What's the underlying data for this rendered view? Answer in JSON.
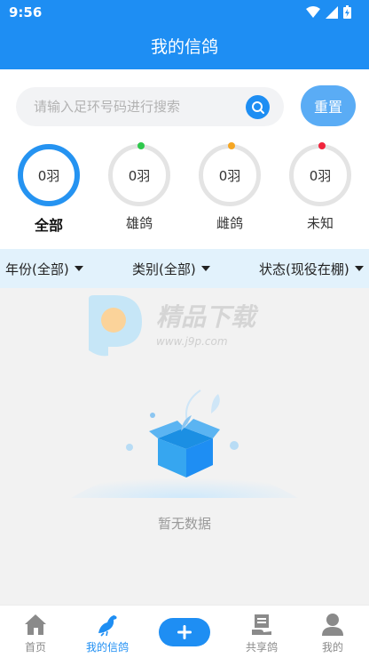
{
  "status_bar": {
    "time": "9:56"
  },
  "header": {
    "title": "我的信鸽"
  },
  "search": {
    "placeholder": "请输入足环号码进行搜索",
    "value": "",
    "reset_label": "重置"
  },
  "categories": [
    {
      "count": "0羽",
      "label": "全部",
      "active": true
    },
    {
      "count": "0羽",
      "label": "雄鸽",
      "dot_color": "#2ec84c"
    },
    {
      "count": "0羽",
      "label": "雌鸽",
      "dot_color": "#f5a623"
    },
    {
      "count": "0羽",
      "label": "未知",
      "dot_color": "#f0243c"
    }
  ],
  "filters": [
    {
      "label": "年份(全部)"
    },
    {
      "label": "类别(全部)"
    },
    {
      "label": "状态(现役在棚)"
    }
  ],
  "watermark": {
    "title": "精品下载",
    "url": "www.j9p.com"
  },
  "empty": {
    "text": "暂无数据"
  },
  "tabs": [
    {
      "label": "首页",
      "icon": "home-icon"
    },
    {
      "label": "我的信鸽",
      "icon": "pigeon-icon",
      "active": true
    },
    {
      "label": "",
      "icon": "add-icon"
    },
    {
      "label": "共享鸽",
      "icon": "share-icon"
    },
    {
      "label": "我的",
      "icon": "user-icon"
    }
  ],
  "colors": {
    "primary": "#1e8ef3",
    "filter_bg": "#e2f2fc",
    "male": "#2ec84c",
    "female": "#f5a623",
    "unknown": "#f0243c"
  }
}
